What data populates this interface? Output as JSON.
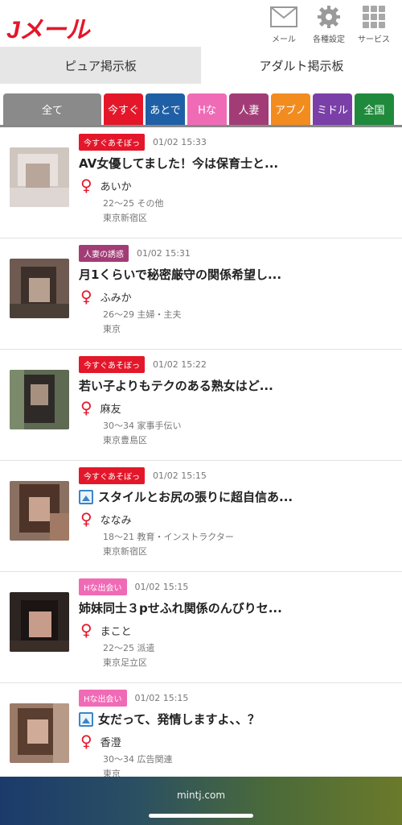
{
  "app": {
    "logo": "Jメール"
  },
  "header_nav": [
    {
      "label": "メール",
      "icon": "mail-icon"
    },
    {
      "label": "各種設定",
      "icon": "gear-icon"
    },
    {
      "label": "サービス",
      "icon": "grid-icon"
    }
  ],
  "board_tabs": [
    {
      "label": "ピュア掲示板",
      "active": true
    },
    {
      "label": "アダルト掲示板",
      "active": false
    }
  ],
  "categories": [
    {
      "label": "全て",
      "color": "#8a8a8a"
    },
    {
      "label": "今すぐ",
      "color": "#e4172a"
    },
    {
      "label": "あとで",
      "color": "#1f5fa6"
    },
    {
      "label": "Hな",
      "color": "#f06bb6"
    },
    {
      "label": "人妻",
      "color": "#a23c76"
    },
    {
      "label": "アブノ",
      "color": "#f28c1f"
    },
    {
      "label": "ミドル",
      "color": "#7b3fa8"
    },
    {
      "label": "全国",
      "color": "#1f8a3c"
    }
  ],
  "posts": [
    {
      "badge": "今すぐあそぼっ",
      "badge_color": "#e4172a",
      "date": "01/02 15:33",
      "title": "AV女優してました！今は保育士と...",
      "has_image": false,
      "name": "あいか",
      "age_job": "22～25 その他",
      "location": "東京新宿区"
    },
    {
      "badge": "人妻の誘惑",
      "badge_color": "#a23c76",
      "date": "01/02 15:31",
      "title": "月1くらいで秘密厳守の関係希望し...",
      "has_image": false,
      "name": "ふみか",
      "age_job": "26～29 主婦・主夫",
      "location": "東京"
    },
    {
      "badge": "今すぐあそぼっ",
      "badge_color": "#e4172a",
      "date": "01/02 15:22",
      "title": "若い子よりもテクのある熟女はど...",
      "has_image": false,
      "name": "麻友",
      "age_job": "30～34 家事手伝い",
      "location": "東京豊島区"
    },
    {
      "badge": "今すぐあそぼっ",
      "badge_color": "#e4172a",
      "date": "01/02 15:15",
      "title": "スタイルとお尻の張りに超自信あ...",
      "has_image": true,
      "name": "ななみ",
      "age_job": "18～21 教育・インストラクター",
      "location": "東京新宿区"
    },
    {
      "badge": "Hな出会い",
      "badge_color": "#f06bb6",
      "date": "01/02 15:15",
      "title": "姉妹同士３pせふれ関係のんびりセ...",
      "has_image": false,
      "name": "まこと",
      "age_job": "22～25 派遣",
      "location": "東京足立区"
    },
    {
      "badge": "Hな出会い",
      "badge_color": "#f06bb6",
      "date": "01/02 15:15",
      "title": "女だって、発情しますよ、、？",
      "has_image": true,
      "name": "香澄",
      "age_job": "30～34 広告関連",
      "location": "東京"
    }
  ],
  "browser": {
    "url": "mintj.com"
  }
}
